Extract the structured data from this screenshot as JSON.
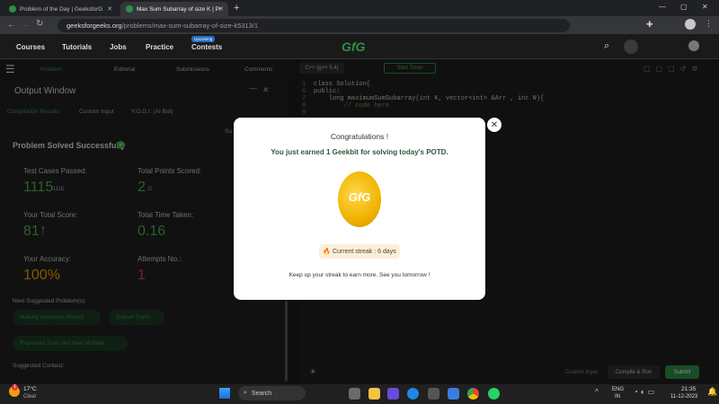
{
  "browser": {
    "tabs": [
      {
        "title": "Problem of the Day | GeeksforG"
      },
      {
        "title": "Max Sum Subarray of size K | Pr"
      }
    ],
    "url_host": "geeksforgeeks.org",
    "url_path": "/problems/max-sum-subarray-of-size-k5313/1"
  },
  "site_nav": {
    "items": [
      "Courses",
      "Tutorials",
      "Jobs",
      "Practice",
      "Contests"
    ],
    "upcoming_badge": "Upcoming",
    "logo": "GfG"
  },
  "problem_tabs": [
    "Problem",
    "Editorial",
    "Submissions",
    "Comments"
  ],
  "output_window": {
    "title": "Output Window",
    "tabs": [
      "Compilation Results",
      "Custom Input",
      "Y.O.G.I. (AI Bot)"
    ],
    "side_label": "Su",
    "status": "Problem Solved Successfully",
    "stats": {
      "test_cases_label": "Test Cases Passed:",
      "test_cases_value": "1115",
      "test_cases_total": "/1115",
      "points_label": "Total Points Scored:",
      "points_value": "2",
      "points_total": "/2",
      "score_label": "Your Total Score:",
      "score_value": "81",
      "time_label": "Total Time Taken:",
      "time_value": "0.16",
      "accuracy_label": "Your Accuracy:",
      "accuracy_value": "100%",
      "attempts_label": "Attempts No.:",
      "attempts_value": "1"
    },
    "next_suggested_label": "Next Suggested Problem(s):",
    "next_suggested": [
      "Making elements distinct",
      "Subset Sums",
      "Repeated Sum and then Multiple"
    ],
    "suggested_contest_label": "Suggested Contest:"
  },
  "editor": {
    "language": "C++ (g++ 5.4)",
    "timer_label": "Start Timer",
    "line_numbers": [
      "1",
      "6",
      "7",
      "8",
      "9"
    ],
    "code_lines": [
      "",
      "class Solution{",
      "public:",
      "    long maximumSumSubarray(int K, vector<int> &Arr , int N){",
      "        // code here"
    ],
    "custom_input_label": "Custom Input",
    "compile_label": "Compile & Run",
    "submit_label": "Submit"
  },
  "modal": {
    "title": "Congratulations !",
    "message": "You just earned 1 Geekbit for solving today's POTD.",
    "coin_label": "GfG",
    "streak_icon": "🔥",
    "streak": "Current streak : 6 days",
    "footer": "Keep up your streak to earn more. See you tomorrow !",
    "close_glyph": "✕"
  },
  "taskbar": {
    "temperature": "17°C",
    "weather": "Clear",
    "search_label": "Search",
    "lang": "ENG",
    "region": "IN",
    "time": "21:35",
    "date": "11-12-2023",
    "notification_count": "1"
  },
  "colors": {
    "brand_green": "#2f8d46",
    "success_green": "#4caf50",
    "accent_orange": "#f0a500",
    "error_red": "#e53935"
  }
}
